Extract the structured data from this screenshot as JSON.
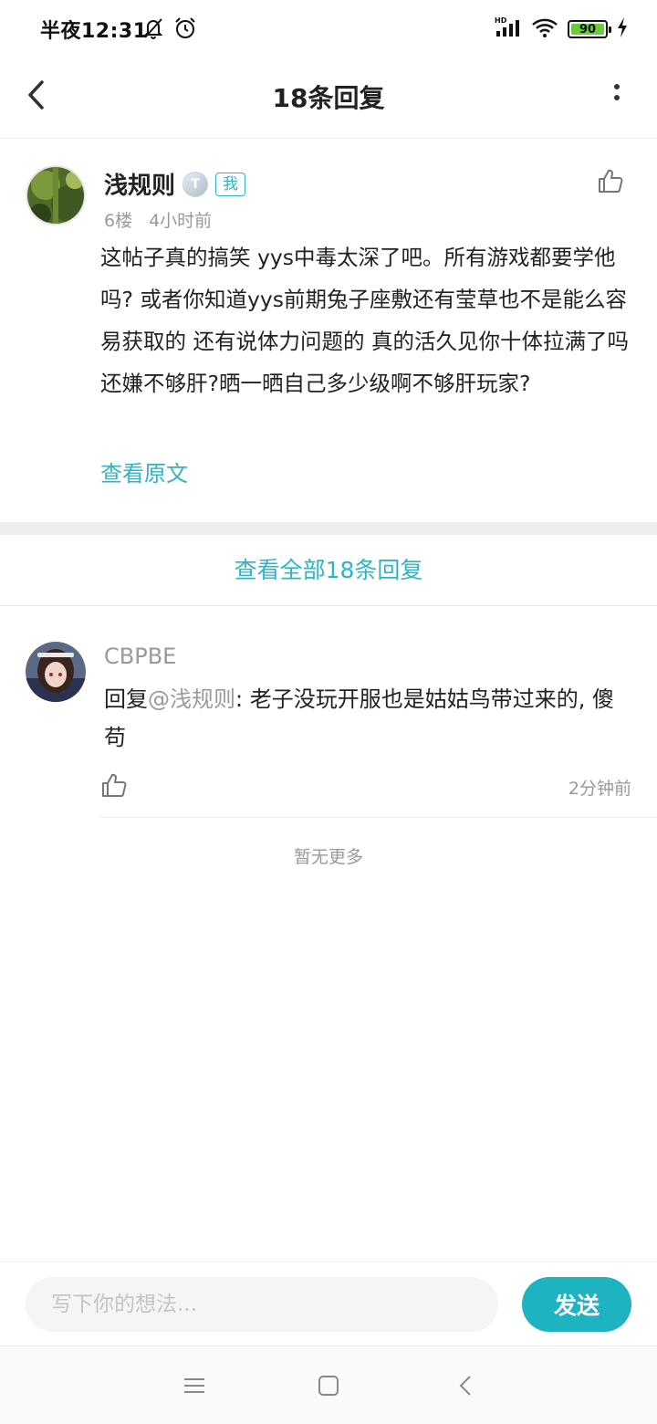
{
  "status_bar": {
    "time": "半夜12:31",
    "battery_level": "90",
    "network_label": "HD"
  },
  "header": {
    "title": "18条回复"
  },
  "post": {
    "author": "浅规则",
    "level_badge": "T",
    "me_badge": "我",
    "floor": "6楼",
    "time": "4小时前",
    "body": "这帖子真的搞笑 yys中毒太深了吧。所有游戏都要学他吗? 或者你知道yys前期兔子座敷还有莹草也不是能么容易获取的 还有说体力问题的 真的活久见你十体拉满了吗还嫌不够肝?晒一晒自己多少级啊不够肝玩家?",
    "view_original": "查看原文"
  },
  "view_all": "查看全部18条回复",
  "reply": {
    "author": "CBPBE",
    "prefix": "回复",
    "mention": "@浅规则",
    "content": ": 老子没玩开服也是姑姑鸟带过来的, 傻苟",
    "time": "2分钟前"
  },
  "no_more": "暂无更多",
  "input_bar": {
    "placeholder": "写下你的想法...",
    "send_label": "发送"
  },
  "colors": {
    "accent": "#2fb5c5",
    "send_button": "#1eb3c1"
  }
}
